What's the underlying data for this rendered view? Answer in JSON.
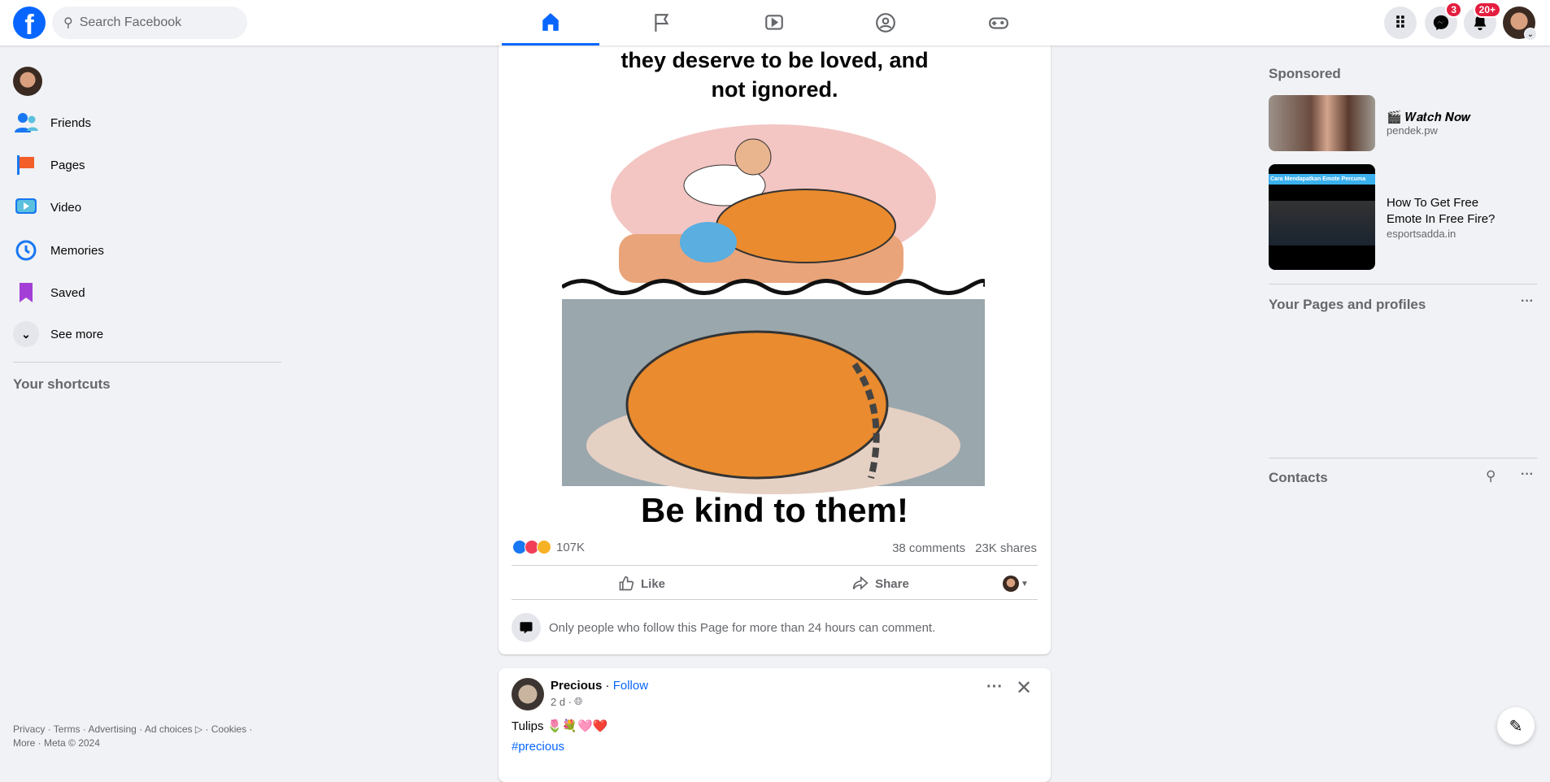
{
  "nav": {
    "search_placeholder": "Search Facebook",
    "messenger_badge": "3",
    "notifications_badge": "20+"
  },
  "sidebar": {
    "items": [
      {
        "label": "Friends"
      },
      {
        "label": "Pages"
      },
      {
        "label": "Video"
      },
      {
        "label": "Memories"
      },
      {
        "label": "Saved"
      },
      {
        "label": "See more"
      }
    ],
    "shortcuts_title": "Your shortcuts",
    "footer_line1": "Privacy · Terms · Advertising · Ad choices ▷ · Cookies ·",
    "footer_line2": "More · Meta © 2024"
  },
  "post1": {
    "image_caption_top": "they deserve to be loved, and not ignored.",
    "image_caption_bottom": "Be kind to them!",
    "reaction_count": "107K",
    "comments": "38 comments",
    "shares": "23K shares",
    "like_label": "Like",
    "share_label": "Share",
    "comment_notice": "Only people who follow this Page for more than 24 hours can comment."
  },
  "post2": {
    "author": "Precious",
    "follow": "Follow",
    "time": "2 d ·",
    "text": "Tulips 🌷💐🩷❤️",
    "hashtag": "#precious"
  },
  "right": {
    "sponsored_title": "Sponsored",
    "ads": [
      {
        "title": "🎬 𝑾𝒂𝒕𝒄𝒉 𝑵𝒐𝒘",
        "domain": "pendek.pw",
        "thumb_text": ""
      },
      {
        "title": "How To Get Free Emote In Free Fire?",
        "domain": "esportsadda.in",
        "thumb_text": "Cara Mendapatkan Emote Percuma"
      }
    ],
    "pages_title": "Your Pages and profiles",
    "contacts_title": "Contacts"
  },
  "colors": {
    "brand": "#0866ff",
    "badge": "#e41e3f"
  }
}
